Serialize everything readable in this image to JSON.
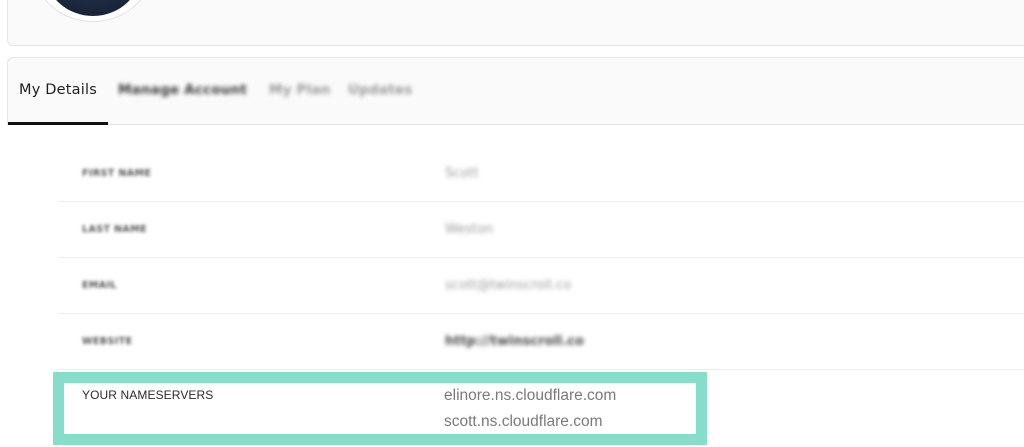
{
  "profile": {
    "avatar_icon": "user-avatar"
  },
  "tabs": [
    {
      "label": "My Details",
      "active": true
    },
    {
      "label": "Manage Account",
      "active": false
    },
    {
      "label": "My Plan",
      "active": false
    },
    {
      "label": "Updates",
      "active": false
    }
  ],
  "details": {
    "first_name": {
      "label": "FIRST NAME",
      "value": "Scott"
    },
    "last_name": {
      "label": "LAST NAME",
      "value": "Weston"
    },
    "email": {
      "label": "EMAIL",
      "value": "scott@twinscroll.co"
    },
    "website": {
      "label": "WEBSITE",
      "value": "http://twinscroll.co"
    }
  },
  "nameservers": {
    "label": "YOUR NAMESERVERS",
    "values": [
      "elinore.ns.cloudflare.com",
      "scott.ns.cloudflare.com"
    ],
    "highlight_color": "#86ddca"
  }
}
